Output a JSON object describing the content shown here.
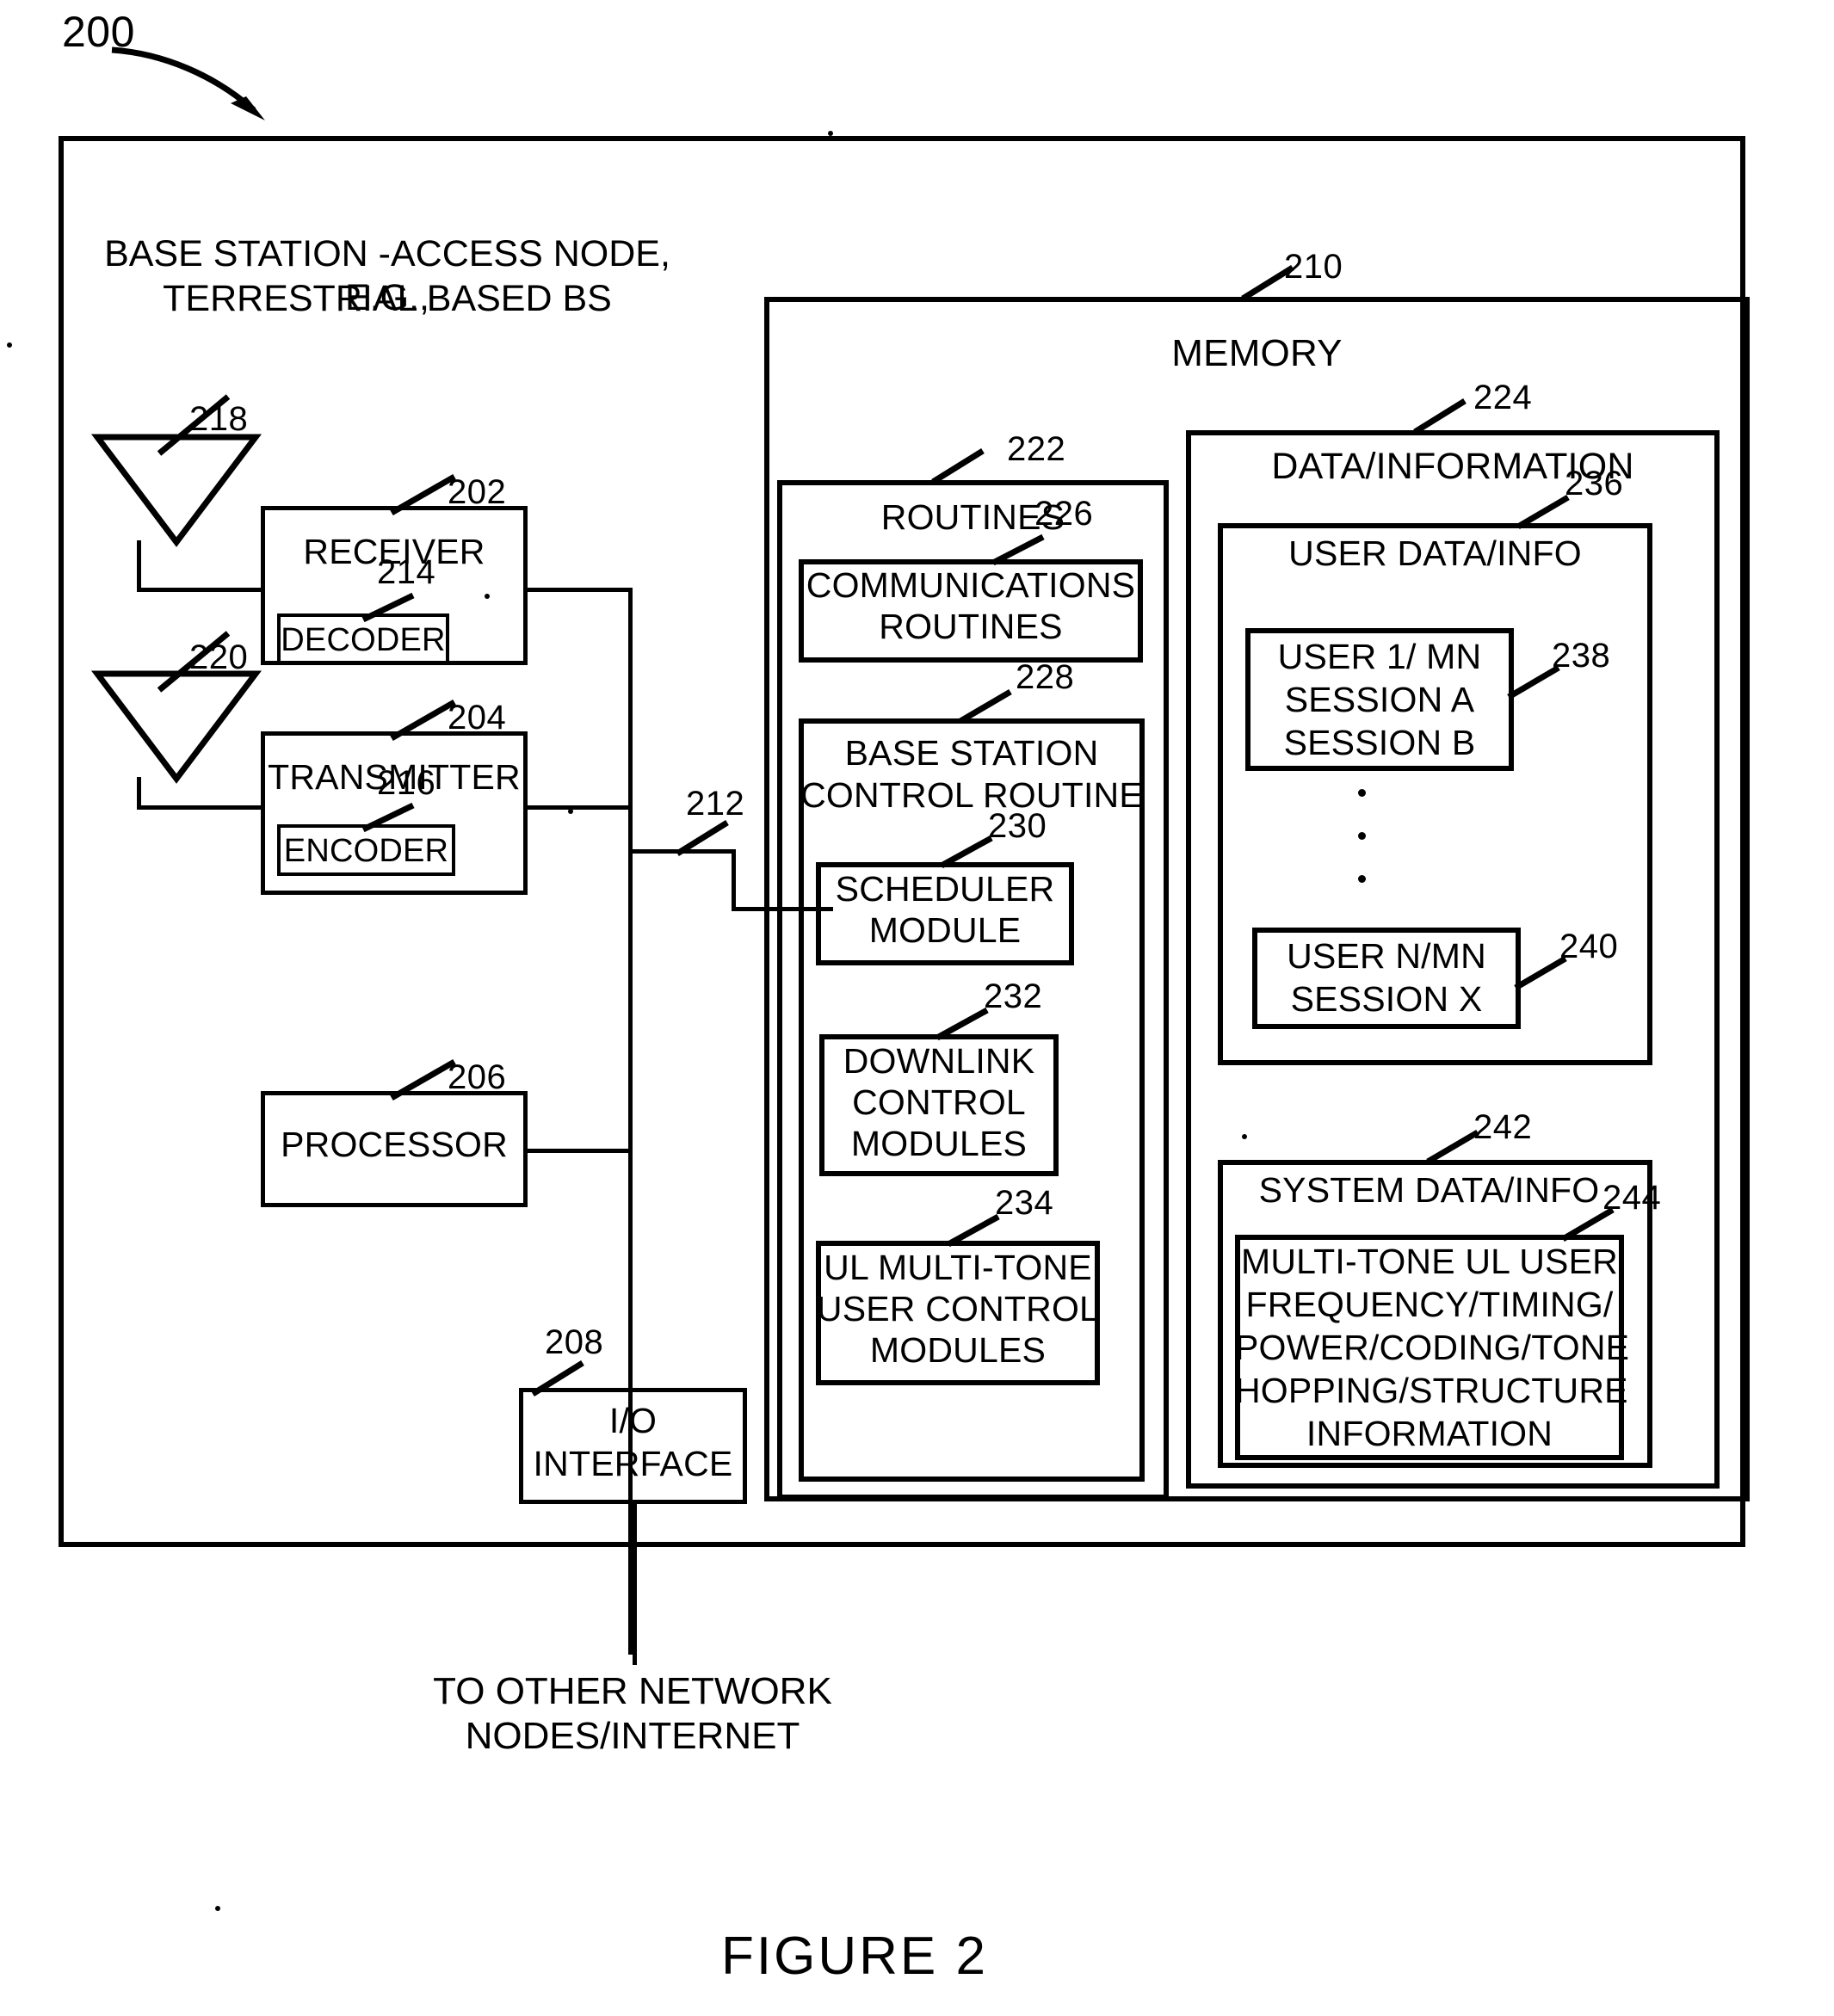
{
  "figure": {
    "number": "200",
    "caption": "FIGURE  2",
    "outer_title_line1": "BASE STATION -ACCESS NODE, E.G.,",
    "outer_title_line2": "TERRESTRIAL BASED BS"
  },
  "refs": {
    "system": "200",
    "receiver": "202",
    "transmitter": "204",
    "processor": "206",
    "io_interface": "208",
    "memory": "210",
    "bus": "212",
    "decoder": "214",
    "encoder": "216",
    "antenna_rx": "218",
    "antenna_tx": "220",
    "routines": "222",
    "data_information": "224",
    "communications_routines": "226",
    "bs_control_routine": "228",
    "scheduler_module": "230",
    "downlink_control_modules": "232",
    "ul_multitone_user_control_modules": "234",
    "user_data_info": "236",
    "user1": "238",
    "userN": "240",
    "system_data_info": "242",
    "multitone_ul_info": "244"
  },
  "blocks": {
    "receiver": "RECEIVER",
    "decoder": "DECODER",
    "transmitter": "TRANSMITTER",
    "encoder": "ENCODER",
    "processor": "PROCESSOR",
    "io_interface_line1": "I/O",
    "io_interface_line2": "INTERFACE",
    "memory": "MEMORY",
    "routines": "ROUTINES",
    "communications_routines_line1": "COMMUNICATIONS",
    "communications_routines_line2": "ROUTINES",
    "bs_control_routine_line1": "BASE STATION",
    "bs_control_routine_line2": "CONTROL ROUTINE",
    "scheduler_module_line1": "SCHEDULER",
    "scheduler_module_line2": "MODULE",
    "downlink_control_line1": "DOWNLINK",
    "downlink_control_line2": "CONTROL",
    "downlink_control_line3": "MODULES",
    "ul_multitone_line1": "UL MULTI-TONE",
    "ul_multitone_line2": "USER CONTROL",
    "ul_multitone_line3": "MODULES",
    "data_information": "DATA/INFORMATION",
    "user_data_info": "USER DATA/INFO",
    "user1_line1": "USER 1/ MN",
    "user1_line2": "SESSION A",
    "user1_line3": "SESSION B",
    "userN_line1": "USER N/MN",
    "userN_line2": "SESSION X",
    "system_data_info": "SYSTEM DATA/INFO",
    "multitone_line1": "MULTI-TONE UL USER",
    "multitone_line2": "FREQUENCY/TIMING/",
    "multitone_line3": "POWER/CODING/TONE",
    "multitone_line4": "HOPPING/STRUCTURE",
    "multitone_line5": "INFORMATION"
  },
  "annotations": {
    "to_network_line1": "TO OTHER NETWORK",
    "to_network_line2": "NODES/INTERNET"
  },
  "colors": {
    "ink": "#000000",
    "paper": "#ffffff"
  }
}
